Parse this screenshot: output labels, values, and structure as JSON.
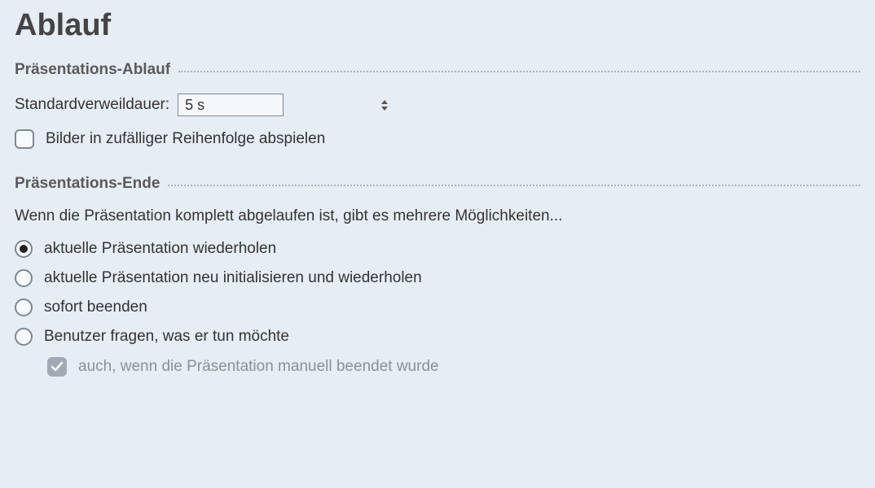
{
  "page_title": "Ablauf",
  "sections": {
    "flow": {
      "legend": "Präsentations-Ablauf",
      "dwell_label": "Standardverweildauer:",
      "dwell_value": "5 s",
      "shuffle_label": "Bilder in zufälliger Reihenfolge abspielen",
      "shuffle_checked": false
    },
    "end": {
      "legend": "Präsentations-Ende",
      "description": "Wenn die Präsentation komplett abgelaufen ist, gibt es mehrere Möglichkeiten...",
      "options": [
        {
          "label": "aktuelle Präsentation wiederholen",
          "selected": true
        },
        {
          "label": "aktuelle Präsentation neu initialisieren und wiederholen",
          "selected": false
        },
        {
          "label": "sofort beenden",
          "selected": false
        },
        {
          "label": "Benutzer fragen, was er tun möchte",
          "selected": false
        }
      ],
      "manual_end_label": "auch, wenn die Präsentation manuell beendet wurde",
      "manual_end_checked": true,
      "manual_end_enabled": false
    }
  }
}
